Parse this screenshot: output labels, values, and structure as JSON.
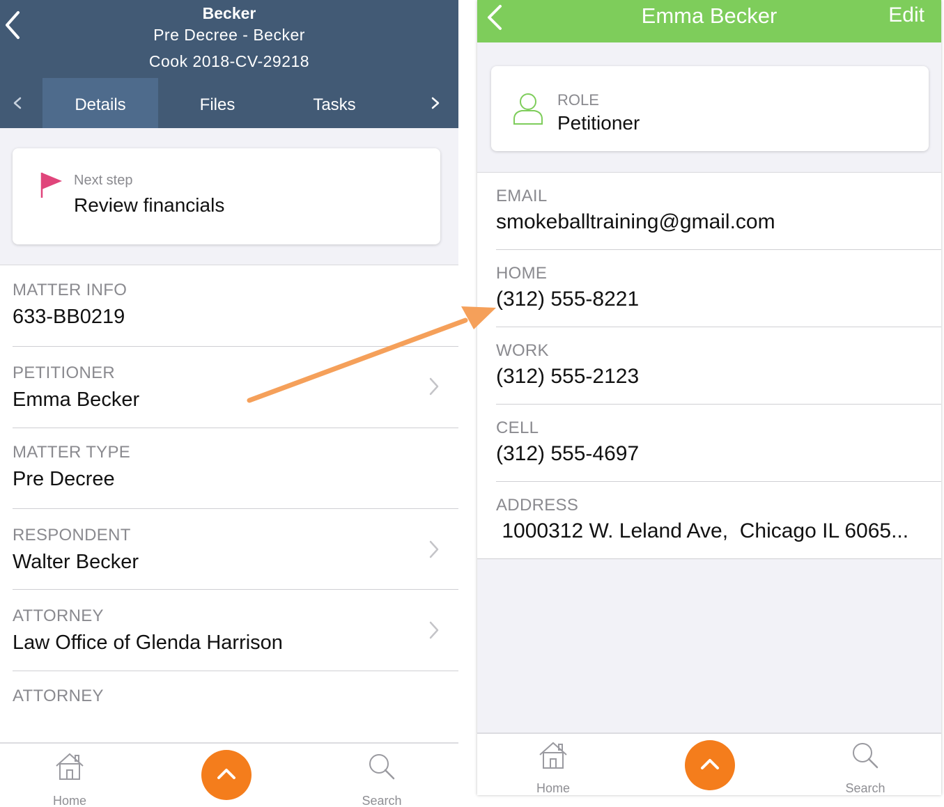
{
  "left": {
    "header": {
      "title": "Becker",
      "subtitle": "Pre Decree - Becker",
      "case_number": "Cook 2018-CV-29218"
    },
    "tabs": [
      {
        "label": "Details",
        "active": true
      },
      {
        "label": "Files",
        "active": false
      },
      {
        "label": "Tasks",
        "active": false
      }
    ],
    "next_step": {
      "caption": "Next step",
      "value": "Review financials",
      "icon": "flag-icon",
      "icon_color": "#e0457b"
    },
    "rows": [
      {
        "label": "MATTER INFO",
        "value": "633-BB0219",
        "has_chevron": false
      },
      {
        "label": "PETITIONER",
        "value": "Emma Becker",
        "has_chevron": true
      },
      {
        "label": "MATTER TYPE",
        "value": "Pre Decree",
        "has_chevron": false
      },
      {
        "label": "RESPONDENT",
        "value": "Walter Becker",
        "has_chevron": true
      },
      {
        "label": "ATTORNEY",
        "value": "Law Office of Glenda Harrison",
        "has_chevron": true
      },
      {
        "label": "ATTORNEY",
        "value": "",
        "has_chevron": false
      }
    ],
    "tabbar": {
      "home": "Home",
      "search": "Search"
    }
  },
  "right": {
    "header": {
      "title": "Emma Becker",
      "edit": "Edit",
      "color": "#7ecd5b"
    },
    "role": {
      "caption": "ROLE",
      "value": "Petitioner",
      "icon": "person-icon"
    },
    "rows": [
      {
        "label": "EMAIL",
        "value": "smokeballtraining@gmail.com"
      },
      {
        "label": "HOME",
        "value": "(312) 555-8221"
      },
      {
        "label": "WORK",
        "value": "(312) 555-2123"
      },
      {
        "label": "CELL",
        "value": "(312) 555-4697"
      },
      {
        "label": "ADDRESS",
        "value": " 1000312 W. Leland Ave,  Chicago IL 6065..."
      }
    ],
    "tabbar": {
      "home": "Home",
      "search": "Search"
    }
  },
  "colors": {
    "header_left": "#425a75",
    "accent_orange": "#f47d1c",
    "annotation_arrow": "#f5a05a"
  }
}
